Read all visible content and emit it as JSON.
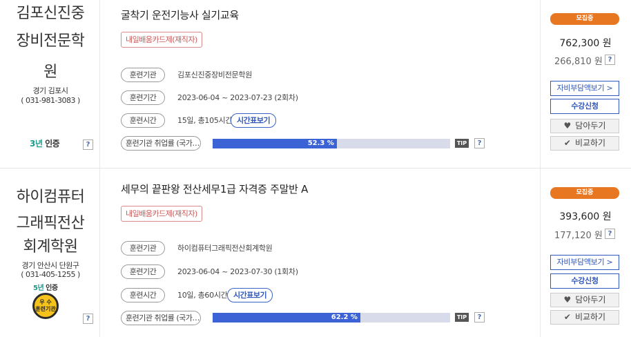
{
  "courses": [
    {
      "institute": {
        "name_lines": [
          "김포신진중",
          "장비전문학",
          "원"
        ],
        "region": "경기 김포시",
        "phone": "( 031-981-3083 )",
        "cert_years": "3년",
        "cert_label": "인증",
        "has_badge": false
      },
      "title": "굴착기 운전기능사 실기교육",
      "tag": "내일배움카드제(재직자)",
      "rows": [
        {
          "label": "훈련기관",
          "value": "김포신진중장비전문학원"
        },
        {
          "label": "훈련기간",
          "value": "2023-06-04 ~ 2023-07-23 (2회차)"
        },
        {
          "label": "훈련시간",
          "value": "15일, 총105시간"
        }
      ],
      "schedule_button": "시간표보기",
      "employment": {
        "label": "훈련기관 취업률 (국가…",
        "value": "52.3 %",
        "percent": 52.3
      },
      "status": "모집중",
      "price": "762,300 원",
      "self_pay": "266,810 원"
    },
    {
      "institute": {
        "name_lines": [
          "하이컴퓨터",
          "그래픽전산",
          "회계학원"
        ],
        "region": "경기 안산시 단원구",
        "phone": "( 031-405-1255 )",
        "cert_years": "5년",
        "cert_label": "인증",
        "has_badge": true,
        "badge_text": [
          "우 수",
          "훈련기관"
        ]
      },
      "title": "세무의 끝판왕 전산세무1급 자격증 주말반 A",
      "tag": "내일배움카드제(재직자)",
      "rows": [
        {
          "label": "훈련기관",
          "value": "하이컴퓨터그래픽전산회계학원"
        },
        {
          "label": "훈련기간",
          "value": "2023-06-04 ~ 2023-07-30 (1회차)"
        },
        {
          "label": "훈련시간",
          "value": "10일, 총60시간"
        }
      ],
      "schedule_button": "시간표보기",
      "employment": {
        "label": "훈련기관 취업률 (국가…",
        "value": "62.2 %",
        "percent": 62.2
      },
      "status": "모집중",
      "price": "393,600 원",
      "self_pay": "177,120 원"
    }
  ],
  "common": {
    "help_glyph": "?",
    "tip_label": "TIP",
    "self_pay_button": "자비부담액보기 >",
    "apply_button": "수강신청",
    "wishlist_button": "담아두기",
    "compare_button": "비교하기",
    "heart_icon": "heart-icon",
    "check_icon": "check-icon",
    "accent_color": "#3b63d6",
    "status_color": "#e87722"
  }
}
